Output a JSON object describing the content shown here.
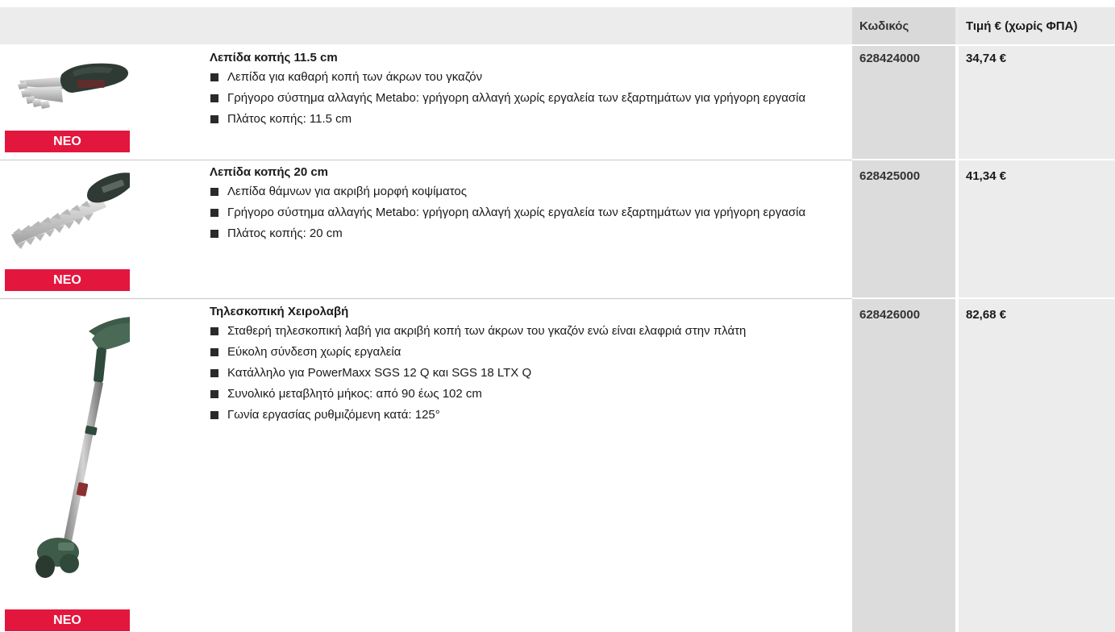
{
  "table": {
    "headers": {
      "code": "Κωδικός",
      "price": "Τιμή € (χωρίς ΦΠΑ)"
    },
    "products": [
      {
        "title": "Λεπίδα κοπής 11.5 cm",
        "badge": "NEO",
        "code": "628424000",
        "price": "34,74 €",
        "image_icon": "short-shear-blade-icon",
        "bullets": [
          "Λεπίδα για καθαρή κοπή των άκρων του γκαζόν",
          "Γρήγορο σύστημα αλλαγής Metabo: γρήγορη αλλαγή χωρίς εργαλεία των εξαρτημάτων για γρήγορη εργασία",
          "Πλάτος κοπής: 11.5 cm"
        ]
      },
      {
        "title": "Λεπίδα κοπής 20 cm",
        "badge": "NEO",
        "code": "628425000",
        "price": "41,34 €",
        "image_icon": "long-hedge-blade-icon",
        "bullets": [
          "Λεπίδα θάμνων για ακριβή μορφή κοψίματος",
          "Γρήγορο σύστημα αλλαγής Metabo: γρήγορη αλλαγή χωρίς εργαλεία των εξαρτημάτων για γρήγορη εργασία",
          "Πλάτος κοπής: 20 cm"
        ]
      },
      {
        "title": "Τηλεσκοπική Χειρολαβή",
        "badge": "NEO",
        "code": "628426000",
        "price": "82,68 €",
        "image_icon": "telescopic-handle-icon",
        "bullets": [
          "Σταθερή τηλεσκοπική λαβή για ακριβή κοπή των άκρων του γκαζόν ενώ είναι ελαφριά στην πλάτη",
          "Εύκολη σύνδεση χωρίς εργαλεία",
          "Κατάλληλο για PowerMaxx SGS 12 Q και SGS 18 LTX Q",
          "Συνολικό μεταβλητό μήκος: από 90 έως 102 cm",
          "Γωνία εργασίας ρυθμιζόμενη κατά: 125°"
        ]
      }
    ]
  },
  "colors": {
    "badge": "#e3173e",
    "header_bg": "#ececec",
    "code_col_bg": "#dcdcdc",
    "price_col_bg": "#ececec"
  }
}
